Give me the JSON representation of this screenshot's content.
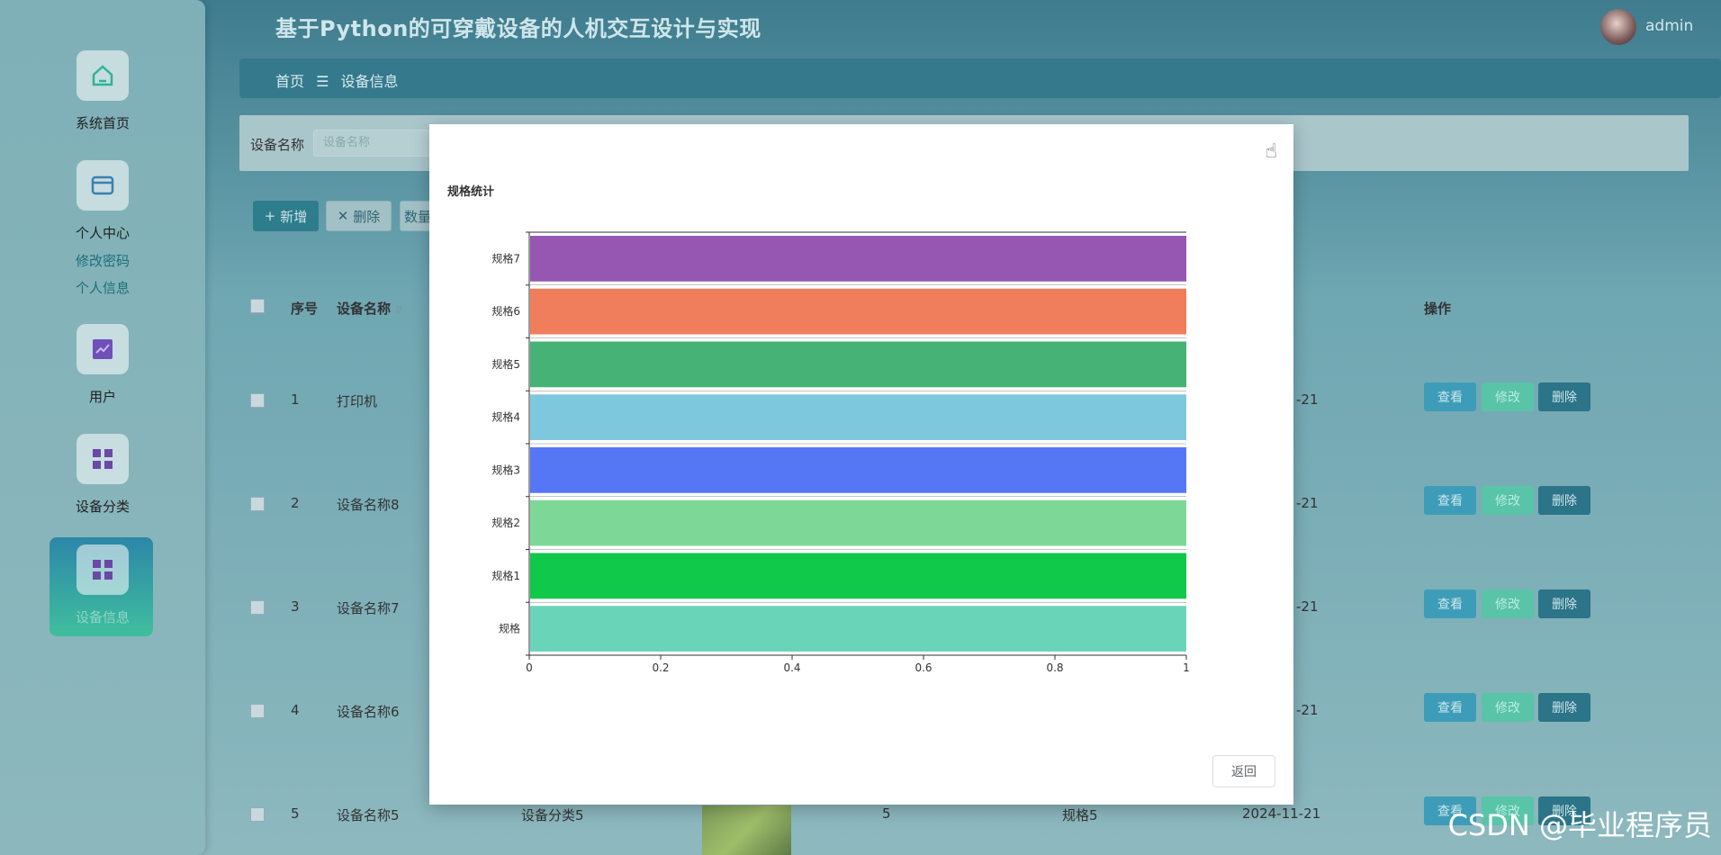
{
  "app": {
    "title": "基于Python的可穿戴设备的人机交互设计与实现",
    "user": "admin"
  },
  "breadcrumb": {
    "home": "首页",
    "separator": "☰",
    "current": "设备信息"
  },
  "sidebar": {
    "items": [
      {
        "label": "系统首页",
        "icon": "home-icon"
      },
      {
        "label": "个人中心",
        "icon": "profile-card-icon",
        "children": [
          "修改密码",
          "个人信息"
        ]
      },
      {
        "label": "用户",
        "icon": "chart-icon"
      },
      {
        "label": "设备分类",
        "icon": "grid-icon"
      },
      {
        "label": "设备信息",
        "icon": "grid-icon",
        "active": true
      }
    ]
  },
  "search": {
    "label": "设备名称",
    "placeholder": "设备名称"
  },
  "toolbar": {
    "add": "新增",
    "delete": "删除",
    "stat": "数量"
  },
  "table": {
    "headers": {
      "index": "序号",
      "name": "设备名称",
      "ops": "操作"
    },
    "rows": [
      {
        "index": "1",
        "name": "打印机",
        "date": "-21"
      },
      {
        "index": "2",
        "name": "设备名称8",
        "date": "-21"
      },
      {
        "index": "3",
        "name": "设备名称7",
        "date": "-21"
      },
      {
        "index": "4",
        "name": "设备名称6",
        "date": "-21"
      },
      {
        "index": "5",
        "name": "设备名称5",
        "category": "设备分类5",
        "count": "5",
        "spec": "规格5",
        "date": "2024-11-21"
      }
    ],
    "op_labels": {
      "view": "查看",
      "edit": "修改",
      "delete": "删除"
    }
  },
  "modal": {
    "back": "返回",
    "chart_title": "规格统计"
  },
  "chart_data": {
    "type": "bar",
    "orientation": "horizontal",
    "title": "规格统计",
    "categories": [
      "规格",
      "规格1",
      "规格2",
      "规格3",
      "规格4",
      "规格5",
      "规格6",
      "规格7"
    ],
    "values": [
      1,
      1,
      1,
      1,
      1,
      1,
      1,
      1
    ],
    "colors": [
      "#6ad4b8",
      "#10c84a",
      "#7dd898",
      "#5577f6",
      "#7ec8de",
      "#46b275",
      "#f07d5c",
      "#9657b2"
    ],
    "xlim": [
      0,
      1
    ],
    "xticks": [
      "0",
      "0.2",
      "0.4",
      "0.6",
      "0.8",
      "1"
    ]
  },
  "watermark": "CSDN @毕业程序员"
}
